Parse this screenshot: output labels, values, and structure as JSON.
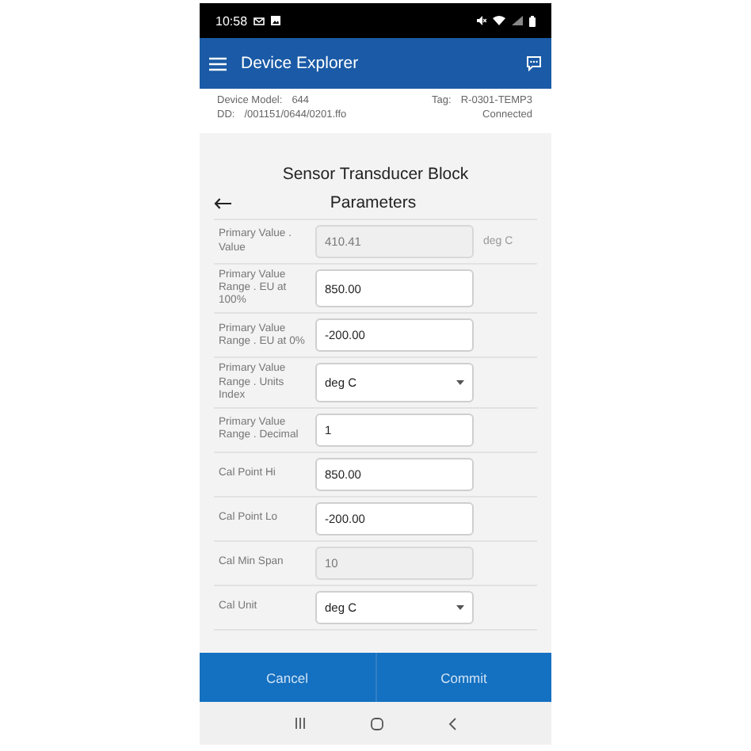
{
  "status_bar": {
    "time": "10:58"
  },
  "app_bar": {
    "title": "Device Explorer"
  },
  "device_info": {
    "model_label": "Device Model:",
    "model_value": "644",
    "dd_label": "DD:",
    "dd_value": "/001151/0644/0201.ffo",
    "tag_label": "Tag:",
    "tag_value": "R-0301-TEMP3",
    "connection": "Connected"
  },
  "block_title": "Sensor Transducer Block",
  "section_title": "Parameters",
  "parameters": [
    {
      "label": "Primary Value . Value",
      "kind": "readonly",
      "value": "410.41",
      "unit": "deg C"
    },
    {
      "label": "Primary Value Range . EU at 100%",
      "kind": "text",
      "value": "850.00"
    },
    {
      "label": "Primary Value Range . EU at 0%",
      "kind": "text",
      "value": "-200.00"
    },
    {
      "label": "Primary Value Range . Units Index",
      "kind": "select",
      "value": "deg C"
    },
    {
      "label": "Primary Value Range . Decimal",
      "kind": "text",
      "value": "1"
    },
    {
      "label": "Cal Point Hi",
      "kind": "text",
      "value": "850.00"
    },
    {
      "label": "Cal Point Lo",
      "kind": "text",
      "value": "-200.00"
    },
    {
      "label": "Cal Min Span",
      "kind": "readonly",
      "value": "10"
    },
    {
      "label": "Cal Unit",
      "kind": "select",
      "value": "deg C"
    }
  ],
  "actions": [
    "Cancel",
    "Commit"
  ]
}
